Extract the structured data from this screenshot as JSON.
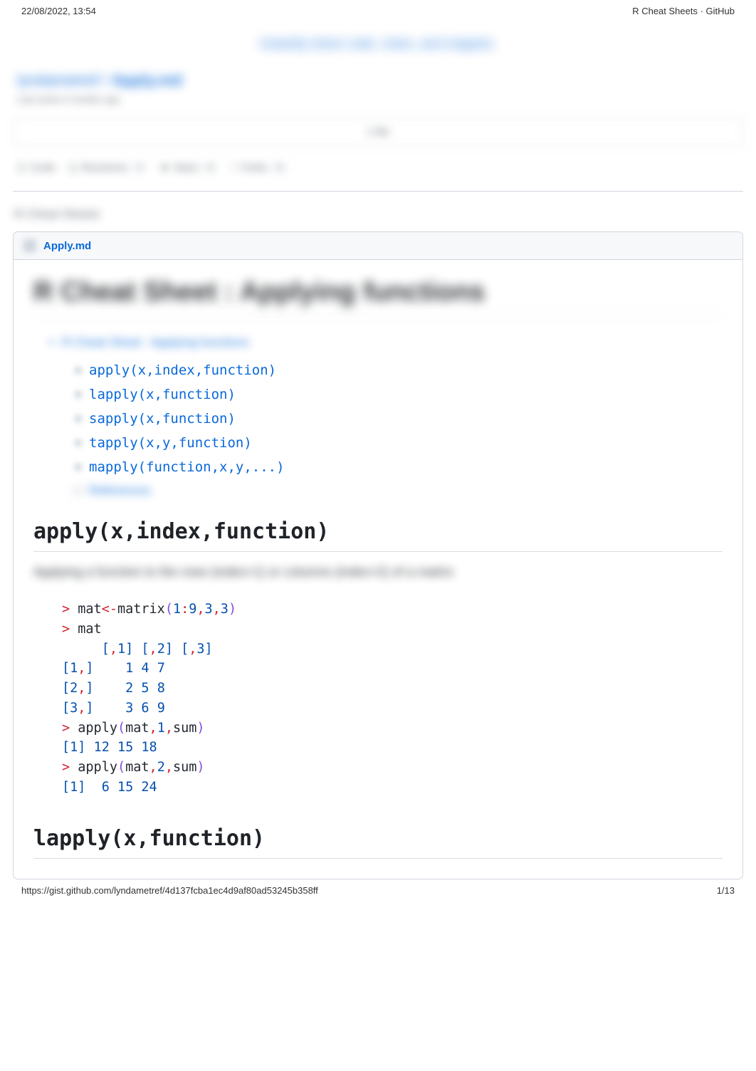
{
  "print": {
    "datetime": "22/08/2022, 13:54",
    "doc_title": "R Cheat Sheets · GitHub",
    "url": "https://gist.github.com/lyndametref/4d137fcba1ec4d9af80ad53245b358ff",
    "page_indicator": "1/13"
  },
  "banner": {
    "tagline": "Instantly share code, notes, and snippets."
  },
  "gist": {
    "owner": "lyndametref",
    "separator": " / ",
    "name": "Apply.md",
    "last_active": "Last active 6 months ago",
    "file_count_label": "1 file"
  },
  "actions": {
    "code_label": "Code",
    "revisions_label": "Revisions",
    "revisions_count": "1",
    "stars_label": "Stars",
    "stars_count": "4",
    "forks_label": "Forks",
    "forks_count": "4"
  },
  "description": "R Cheat Sheets",
  "file": {
    "name": "Apply.md"
  },
  "doc": {
    "title": "R Cheat Sheet : Applying functions",
    "toc_root": "R Cheat Sheet : Applying functions",
    "toc_items": [
      "apply(x,index,function)",
      "lapply(x,function)",
      "sapply(x,function)",
      "tapply(x,y,function)",
      "mapply(function,x,y,...)"
    ],
    "toc_ref": "References",
    "section1_heading": "apply(x,index,function)",
    "section1_desc": "Applying a function to the rows (index=1) or columns (index=2) of a matrix:",
    "section2_heading": "lapply(x,function)"
  }
}
